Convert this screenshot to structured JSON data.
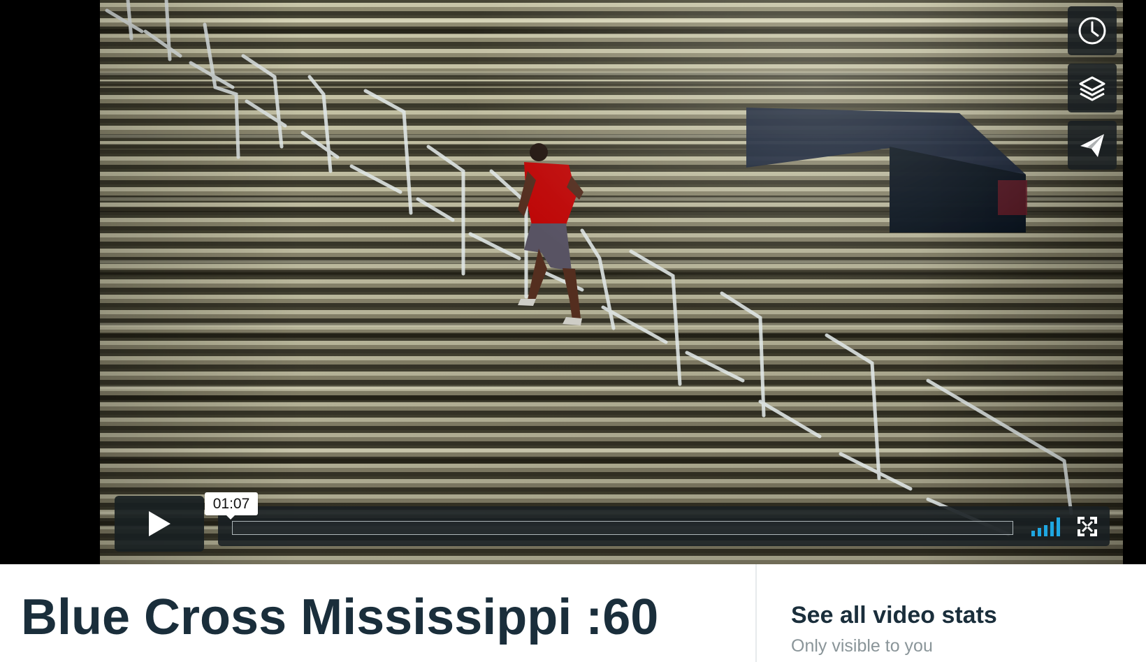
{
  "player": {
    "current_time": "01:07",
    "progress": 0,
    "volume_level": 5,
    "icons": {
      "watch_later": "clock-icon",
      "collections": "layers-icon",
      "share": "paper-plane-icon",
      "play": "play-icon",
      "volume": "volume-bars-icon",
      "fullscreen": "fullscreen-icon"
    },
    "colors": {
      "control_background": "#182022",
      "volume_accent": "#1fa6e0",
      "tooltip_background": "#ffffff"
    }
  },
  "video": {
    "title": "Blue Cross Mississippi :60"
  },
  "stats": {
    "link_label": "See all video stats",
    "visibility_note": "Only visible to you"
  }
}
